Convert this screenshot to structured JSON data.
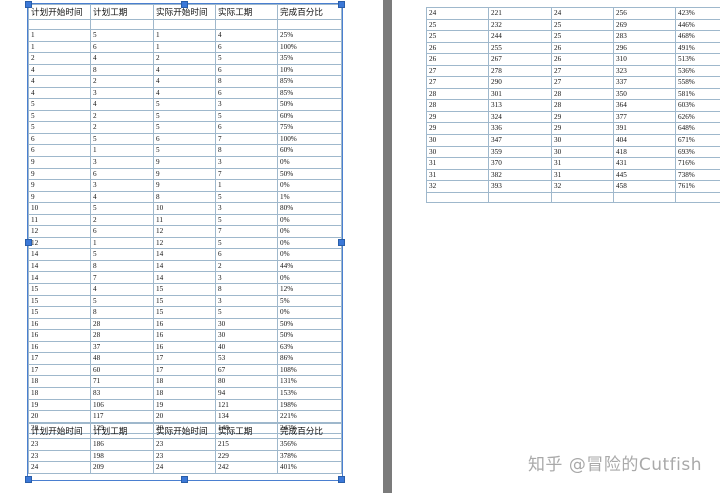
{
  "headers": [
    "计划开始时间",
    "计划工期",
    "实际开始时间",
    "实际工期",
    "完成百分比"
  ],
  "left_rows": [
    [
      "1",
      "5",
      "1",
      "4",
      "25%"
    ],
    [
      "1",
      "6",
      "1",
      "6",
      "100%"
    ],
    [
      "2",
      "4",
      "2",
      "5",
      "35%"
    ],
    [
      "4",
      "8",
      "4",
      "6",
      "10%"
    ],
    [
      "4",
      "2",
      "4",
      "8",
      "85%"
    ],
    [
      "4",
      "3",
      "4",
      "6",
      "85%"
    ],
    [
      "5",
      "4",
      "5",
      "3",
      "50%"
    ],
    [
      "5",
      "2",
      "5",
      "5",
      "60%"
    ],
    [
      "5",
      "2",
      "5",
      "6",
      "75%"
    ],
    [
      "6",
      "5",
      "6",
      "7",
      "100%"
    ],
    [
      "6",
      "1",
      "5",
      "8",
      "60%"
    ],
    [
      "9",
      "3",
      "9",
      "3",
      "0%"
    ],
    [
      "9",
      "6",
      "9",
      "7",
      "50%"
    ],
    [
      "9",
      "3",
      "9",
      "1",
      "0%"
    ],
    [
      "9",
      "4",
      "8",
      "5",
      "1%"
    ],
    [
      "10",
      "5",
      "10",
      "3",
      "80%"
    ],
    [
      "11",
      "2",
      "11",
      "5",
      "0%"
    ],
    [
      "12",
      "6",
      "12",
      "7",
      "0%"
    ],
    [
      "12",
      "1",
      "12",
      "5",
      "0%"
    ],
    [
      "14",
      "5",
      "14",
      "6",
      "0%"
    ],
    [
      "14",
      "8",
      "14",
      "2",
      "44%"
    ],
    [
      "14",
      "7",
      "14",
      "3",
      "0%"
    ],
    [
      "15",
      "4",
      "15",
      "8",
      "12%"
    ],
    [
      "15",
      "5",
      "15",
      "3",
      "5%"
    ],
    [
      "15",
      "8",
      "15",
      "5",
      "0%"
    ],
    [
      "16",
      "28",
      "16",
      "30",
      "50%"
    ],
    [
      "16",
      "28",
      "16",
      "30",
      "50%"
    ],
    [
      "16",
      "37",
      "16",
      "40",
      "63%"
    ],
    [
      "17",
      "48",
      "17",
      "53",
      "86%"
    ],
    [
      "17",
      "60",
      "17",
      "67",
      "108%"
    ],
    [
      "18",
      "71",
      "18",
      "80",
      "131%"
    ],
    [
      "18",
      "83",
      "18",
      "94",
      "153%"
    ],
    [
      "19",
      "106",
      "19",
      "121",
      "198%"
    ],
    [
      "20",
      "117",
      "20",
      "134",
      "221%"
    ],
    [
      "20",
      "129",
      "20",
      "148",
      "243%"
    ]
  ],
  "left_rows_2": [
    [
      "23",
      "186",
      "23",
      "215",
      "356%"
    ],
    [
      "23",
      "198",
      "23",
      "229",
      "378%"
    ],
    [
      "24",
      "209",
      "24",
      "242",
      "401%"
    ]
  ],
  "right_rows": [
    [
      "24",
      "221",
      "24",
      "256",
      "423%"
    ],
    [
      "25",
      "232",
      "25",
      "269",
      "446%"
    ],
    [
      "25",
      "244",
      "25",
      "283",
      "468%"
    ],
    [
      "26",
      "255",
      "26",
      "296",
      "491%"
    ],
    [
      "26",
      "267",
      "26",
      "310",
      "513%"
    ],
    [
      "27",
      "278",
      "27",
      "323",
      "536%"
    ],
    [
      "27",
      "290",
      "27",
      "337",
      "558%"
    ],
    [
      "28",
      "301",
      "28",
      "350",
      "581%"
    ],
    [
      "28",
      "313",
      "28",
      "364",
      "603%"
    ],
    [
      "29",
      "324",
      "29",
      "377",
      "626%"
    ],
    [
      "29",
      "336",
      "29",
      "391",
      "648%"
    ],
    [
      "30",
      "347",
      "30",
      "404",
      "671%"
    ],
    [
      "30",
      "359",
      "30",
      "418",
      "693%"
    ],
    [
      "31",
      "370",
      "31",
      "431",
      "716%"
    ],
    [
      "31",
      "382",
      "31",
      "445",
      "738%"
    ],
    [
      "32",
      "393",
      "32",
      "458",
      "761%"
    ]
  ],
  "watermark": "知乎 @冒险的Cutfish"
}
